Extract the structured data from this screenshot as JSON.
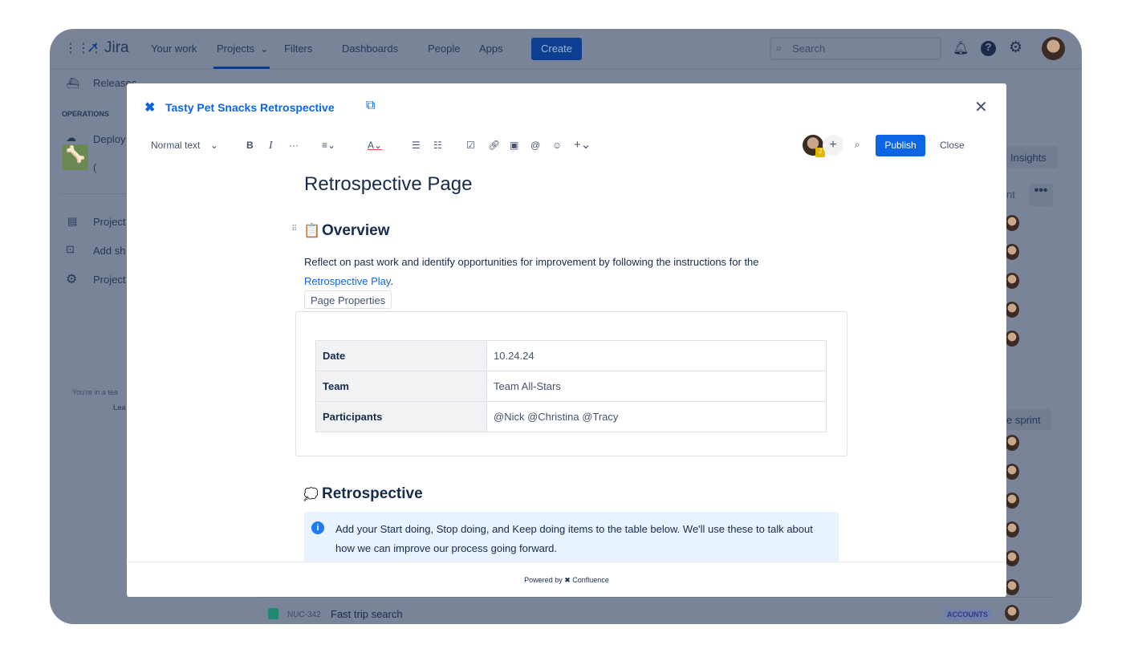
{
  "jira": {
    "logo": "Jira",
    "nav": [
      "Your work",
      "Projects",
      "Filters",
      "Dashboards",
      "People",
      "Apps"
    ],
    "create": "Create",
    "search_placeholder": "Search",
    "sidebar": {
      "releases": "Releases",
      "section": "OPERATIONS",
      "deploy": "Deploy",
      "partial": "(",
      "project_pages": "Project",
      "add_shortcut": "Add sh",
      "project_settings": "Project",
      "team_note": "You're in a tea",
      "learn": "Lea"
    },
    "right": {
      "insights": "Insights",
      "nt": "nt",
      "sprint": "e sprint",
      "issue_key": "NUC-342",
      "issue_title": "Fast trip search",
      "issue_tag": "ACCOUNTS"
    }
  },
  "modal": {
    "title": "Tasty Pet Snacks Retrospective",
    "toolbar": {
      "text_style": "Normal text",
      "publish": "Publish",
      "close": "Close",
      "avatar_badge": "J"
    },
    "page_title": "Retrospective Page",
    "overview": {
      "heading": "Overview",
      "text": "Reflect on past work and identify opportunities for improvement by following the instructions for the",
      "link": "Retrospective Play",
      "after": ".",
      "macro_label": "Page Properties",
      "rows": [
        {
          "key": "Date",
          "value": "10.24.24"
        },
        {
          "key": "Team",
          "value": "Team All-Stars"
        },
        {
          "key": "Participants",
          "value": "@Nick @Christina @Tracy"
        }
      ]
    },
    "retro": {
      "heading": "Retrospective",
      "info": "Add your Start doing, Stop doing, and Keep doing items to the table below. We'll use these to talk about how we can improve our process going forward."
    },
    "footer": {
      "powered": "Powered by",
      "brand": "Confluence"
    }
  },
  "colors": {
    "accent": "#0c66e4",
    "overlay": "#7a8499",
    "info_bg": "#e9f2ff"
  }
}
